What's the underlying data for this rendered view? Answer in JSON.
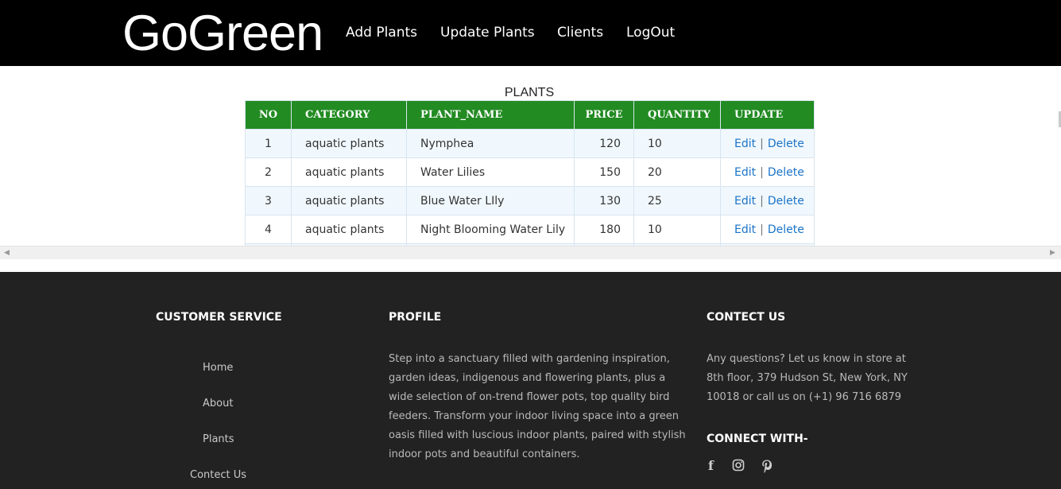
{
  "header": {
    "logo": "GoGreen",
    "nav": [
      "Add Plants",
      "Update Plants",
      "Clients",
      "LogOut"
    ]
  },
  "table": {
    "caption": "PLANTS",
    "columns": [
      "NO",
      "CATEGORY",
      "PLANT_NAME",
      "PRICE",
      "QUANTITY",
      "UPDATE"
    ],
    "rows": [
      {
        "no": "1",
        "category": "aquatic plants",
        "name": "Nymphea",
        "price": "120",
        "quantity": "10"
      },
      {
        "no": "2",
        "category": "aquatic plants",
        "name": "Water Lilies",
        "price": "150",
        "quantity": "20"
      },
      {
        "no": "3",
        "category": "aquatic plants",
        "name": "Blue Water LIly",
        "price": "130",
        "quantity": "25"
      },
      {
        "no": "4",
        "category": "aquatic plants",
        "name": "Night Blooming Water Lily",
        "price": "180",
        "quantity": "10"
      }
    ],
    "edit_label": "Edit",
    "separator": "|",
    "delete_label": "Delete"
  },
  "footer": {
    "customer_service": {
      "heading": "CUSTOMER SERVICE",
      "links": [
        "Home",
        "About",
        "Plants",
        "Contect Us"
      ]
    },
    "profile": {
      "heading": "PROFILE",
      "text": "Step into a sanctuary filled with gardening inspiration, garden ideas, indigenous and flowering plants, plus a wide selection of on-trend flower pots, top quality bird feeders. Transform your indoor living space into a green oasis filled with luscious indoor plants, paired with stylish indoor pots and beautiful containers."
    },
    "contact": {
      "heading": "CONTECT US",
      "text": "Any questions? Let us know in store at 8th floor, 379 Hudson St, New York, NY 10018 or call us on (+1) 96 716 6879",
      "connect_heading": "CONNECT WITH-",
      "social_icons": [
        "facebook-icon",
        "instagram-icon",
        "pinterest-icon"
      ]
    }
  },
  "colors": {
    "header_bg": "#000000",
    "table_header_bg": "#228b22",
    "link": "#1b73c8",
    "footer_bg": "#222222"
  }
}
